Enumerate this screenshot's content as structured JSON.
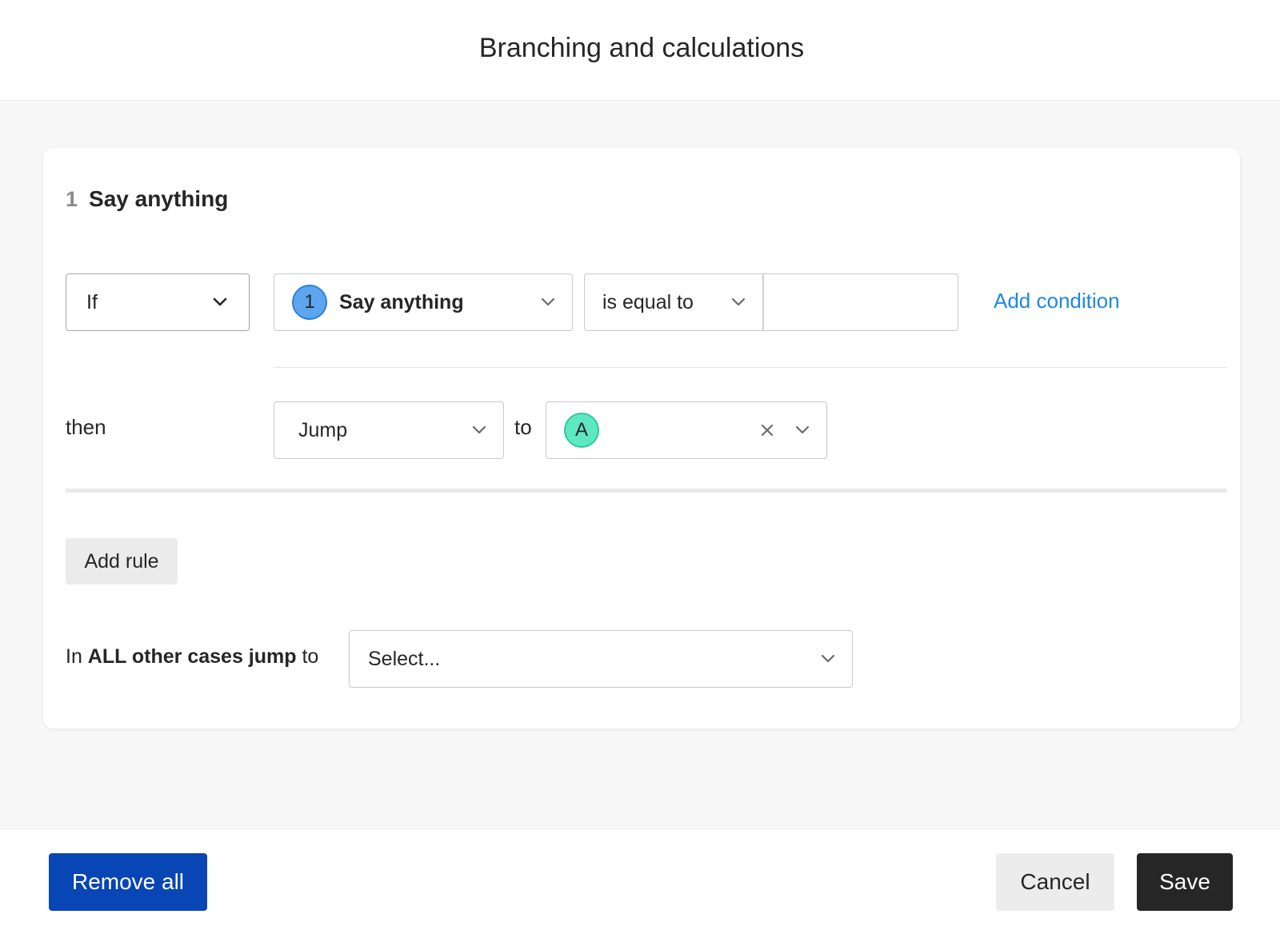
{
  "header": {
    "title": "Branching and calculations"
  },
  "question": {
    "number": "1",
    "name": "Say anything"
  },
  "rule": {
    "condition_type": "If",
    "question_badge": "1",
    "question_label": "Say anything",
    "operator": "is equal to",
    "value": "",
    "add_condition_label": "Add condition",
    "then_label": "then",
    "action": "Jump",
    "to_label": "to",
    "target_badge": "A"
  },
  "add_rule_label": "Add rule",
  "other_cases": {
    "label_prefix": "In ",
    "label_bold": "ALL other cases jump",
    "label_suffix": " to",
    "placeholder": "Select..."
  },
  "footer": {
    "remove_all_label": "Remove all",
    "cancel_label": "Cancel",
    "save_label": "Save"
  },
  "colors": {
    "primary_blue": "#0845b5",
    "link_blue": "#1e87e0",
    "question_badge": "#5da5ef",
    "target_badge": "#5ee8c2",
    "save_dark": "#262626"
  },
  "icons": {
    "chevron": "chevron-down-icon",
    "clear": "close-icon"
  }
}
